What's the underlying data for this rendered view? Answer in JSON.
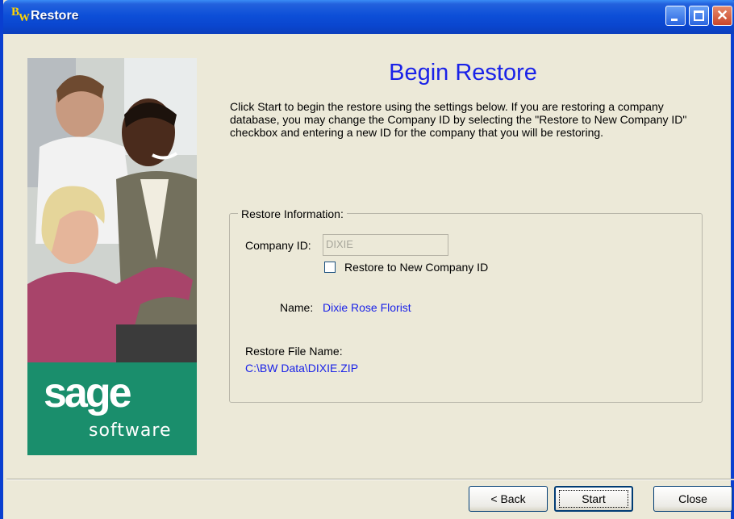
{
  "window": {
    "title": "Restore",
    "icon": "bw-app-icon",
    "controls": [
      "minimize",
      "maximize",
      "close"
    ]
  },
  "brand": {
    "name": "sage",
    "tagline": "software",
    "color": "#1a8e6c"
  },
  "main": {
    "heading": "Begin Restore",
    "intro": "Click Start to begin the restore using the settings below.  If you are restoring a company database, you may change the Company ID by selecting the \"Restore to New Company ID\" checkbox and entering a new ID for the company that you will be restoring."
  },
  "restore_info": {
    "legend": "Restore Information:",
    "company_id_label": "Company ID:",
    "company_id_value": "DIXIE",
    "new_id_checkbox_label": "Restore to New Company ID",
    "new_id_checked": false,
    "name_label": "Name:",
    "name_value": "Dixie Rose Florist",
    "file_label": "Restore File Name:",
    "file_value": "C:\\BW Data\\DIXIE.ZIP"
  },
  "buttons": {
    "back": "< Back",
    "start": "Start",
    "close": "Close"
  },
  "colors": {
    "accent_blue": "#1a22e8",
    "titlebar": "#0a46cf",
    "dialog_bg": "#ece9d8"
  }
}
